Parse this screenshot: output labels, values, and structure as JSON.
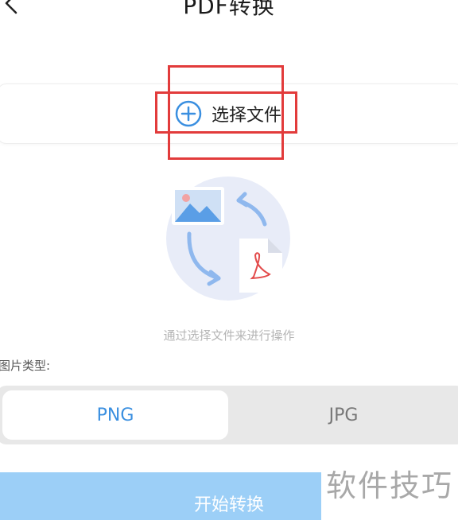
{
  "header": {
    "title": "PDF转换",
    "back_icon": "chevron-left-icon"
  },
  "select_file": {
    "label": "选择文件",
    "icon": "plus-circle-icon",
    "accent": "#3a8fe0"
  },
  "highlight": {
    "color": "#e23b3b"
  },
  "illustration": {
    "icons": [
      "image-icon",
      "pdf-file-icon",
      "convert-arrows-icon"
    ]
  },
  "hint": "通过选择文件来进行操作",
  "image_type": {
    "label": "图片类型:",
    "options": [
      "PNG",
      "JPG"
    ],
    "selected": "PNG"
  },
  "start_button": {
    "label": "开始转换",
    "color": "#9ccff7"
  },
  "watermark": "软件技巧"
}
